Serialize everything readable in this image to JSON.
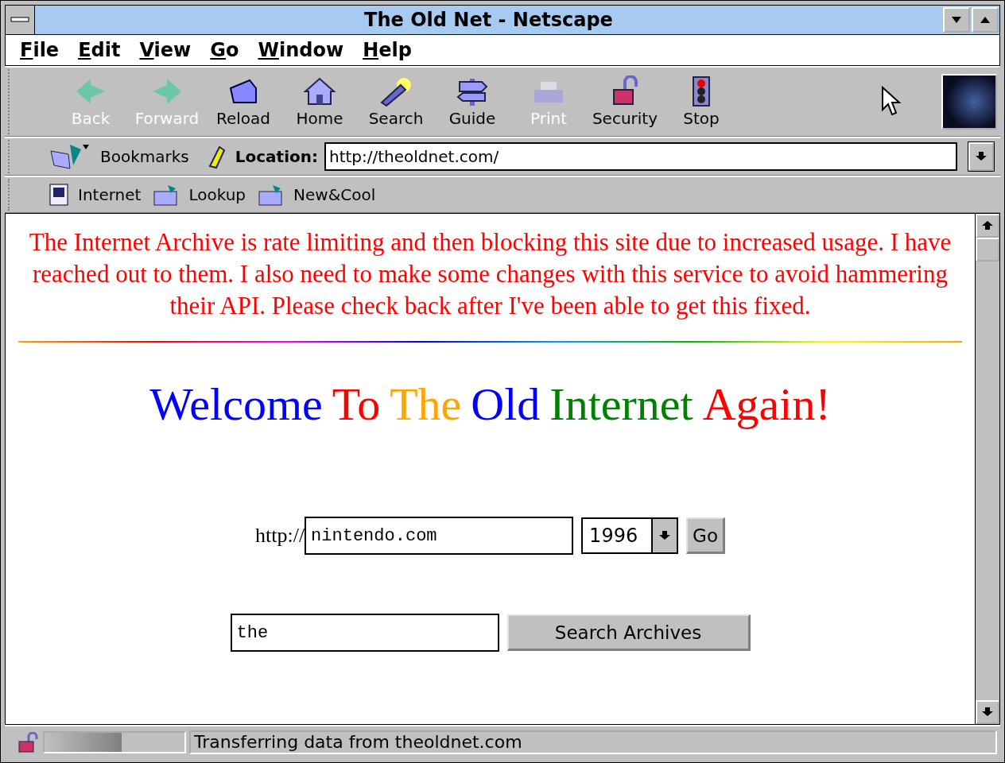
{
  "window": {
    "title": "The Old Net - Netscape"
  },
  "menu": [
    {
      "label": "File"
    },
    {
      "label": "Edit"
    },
    {
      "label": "View"
    },
    {
      "label": "Go"
    },
    {
      "label": "Window"
    },
    {
      "label": "Help"
    }
  ],
  "toolbar": [
    {
      "kind": "back",
      "label": "Back",
      "disabled": true
    },
    {
      "kind": "forward",
      "label": "Forward",
      "disabled": true
    },
    {
      "kind": "reload",
      "label": "Reload",
      "disabled": false
    },
    {
      "kind": "home",
      "label": "Home",
      "disabled": false
    },
    {
      "kind": "search",
      "label": "Search",
      "disabled": false
    },
    {
      "kind": "guide",
      "label": "Guide",
      "disabled": false
    },
    {
      "kind": "print",
      "label": "Print",
      "disabled": true
    },
    {
      "kind": "security",
      "label": "Security",
      "disabled": false
    },
    {
      "kind": "stop",
      "label": "Stop",
      "disabled": false
    }
  ],
  "location_bar": {
    "bookmarks": "Bookmarks",
    "label": "Location:",
    "value": "http://theoldnet.com/"
  },
  "personal_bar": [
    {
      "kind": "page",
      "label": "Internet"
    },
    {
      "kind": "folder",
      "label": "Lookup"
    },
    {
      "kind": "folder",
      "label": "New&Cool"
    }
  ],
  "page": {
    "notice": "The Internet Archive is rate limiting and then blocking this site due to increased usage. I have reached out to them. I also need to make some changes with this service to avoid hammering their API. Please check back after I've been able to get this fixed.",
    "heading": [
      {
        "text": "Welcome",
        "color": "#0000ff"
      },
      {
        "text": "To",
        "color": "#ff0000"
      },
      {
        "text": "The",
        "color": "#ffa500"
      },
      {
        "text": "Old",
        "color": "#0000ff"
      },
      {
        "text": "Internet",
        "color": "#008000"
      },
      {
        "text": "Again!",
        "color": "#ff0000"
      }
    ],
    "url_prefix": "http://",
    "url_value": "nintendo.com",
    "year": "1996",
    "go": "Go",
    "search_value": "the",
    "search_button": "Search Archives"
  },
  "status_bar": {
    "text": "Transferring data from theoldnet.com",
    "level": 0.55
  }
}
